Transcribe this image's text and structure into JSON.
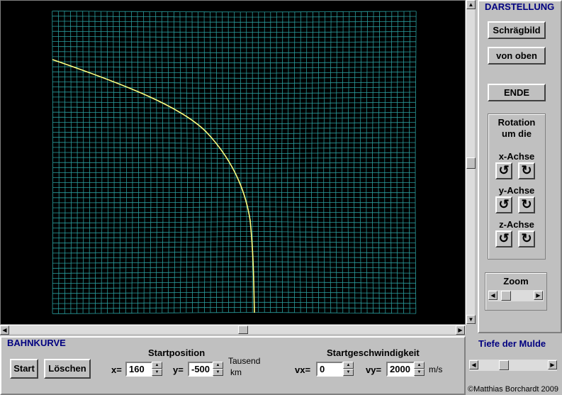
{
  "display": {
    "heading": "DARSTELLUNG",
    "oblique_label": "Schrägbild",
    "top_label": "von oben",
    "end_label": "ENDE",
    "rotation_title_line1": "Rotation",
    "rotation_title_line2": "um die",
    "x_axis_label": "x-Achse",
    "y_axis_label": "y-Achse",
    "z_axis_label": "z-Achse",
    "zoom_label": "Zoom"
  },
  "trajectory": {
    "heading": "BAHNKURVE",
    "start_label": "Start",
    "clear_label": "Löschen",
    "position_heading": "Startposition",
    "x_label": "x=",
    "x_value": "160",
    "y_label": "y=",
    "y_value": "-500",
    "unit_line1": "Tausend",
    "unit_line2": "km",
    "velocity_heading": "Startgeschwindigkeit",
    "vx_label": "vx=",
    "vx_value": "0",
    "vy_label": "vy=",
    "vy_value": "2000",
    "velocity_unit": "m/s"
  },
  "depth": {
    "heading": "Tiefe der Mulde"
  },
  "copyright": "©Matthias Borchardt 2009",
  "colors": {
    "grid": "#2a9d9d",
    "curve": "#ffff80",
    "accent": "#000080"
  }
}
